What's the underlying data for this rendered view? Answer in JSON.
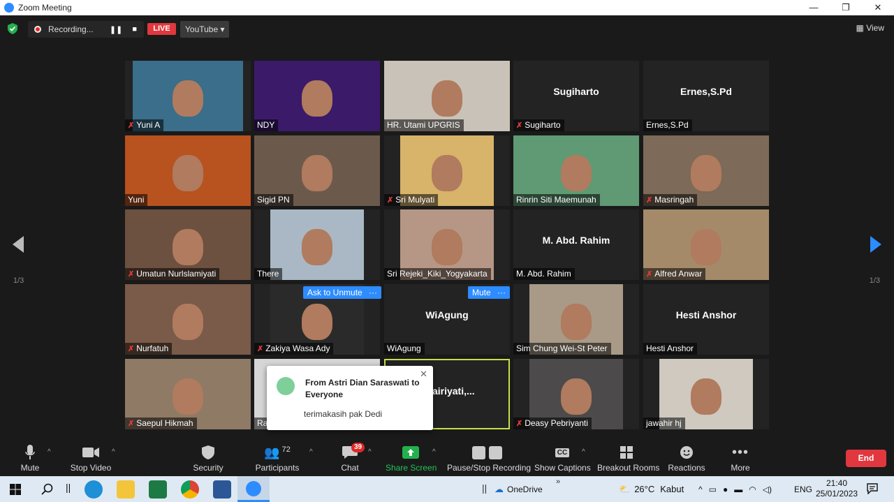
{
  "window": {
    "title": "Zoom Meeting",
    "minimize": "—",
    "restore": "❐",
    "close": "✕"
  },
  "topbar": {
    "recording_label": "Recording...",
    "pause_icon": "❚❚",
    "stop_icon": "■",
    "live_label": "LIVE",
    "stream_target": "YouTube ▾",
    "view_label": "View"
  },
  "pagination": {
    "left": "1/3",
    "right": "1/3"
  },
  "participants": [
    {
      "name": "Yuni A",
      "muted": true,
      "bg": "#3a6e8a"
    },
    {
      "name": "NDY",
      "muted": false,
      "bg": "#3b1a6a"
    },
    {
      "name": "HR. Utami UPGRIS",
      "muted": false,
      "bg": "#c9c2b8"
    },
    {
      "name": "Sugiharto",
      "muted": true,
      "display": "Sugiharto"
    },
    {
      "name": "Ernes,S.Pd",
      "muted": false,
      "display": "Ernes,S.Pd"
    },
    {
      "name": "Yuni",
      "muted": false,
      "bg": "#b8521f"
    },
    {
      "name": "Sigid PN",
      "muted": false,
      "bg": "#6b5a4c"
    },
    {
      "name": "Sri Mulyati",
      "muted": true,
      "bg": "#d8b36a"
    },
    {
      "name": "Rinrin Siti Maemunah",
      "muted": false,
      "bg": "#5f9a74"
    },
    {
      "name": "Masringah",
      "muted": true,
      "bg": "#7d6a58"
    },
    {
      "name": "Umatun Nurlslamiyati",
      "muted": true,
      "bg": "#6c5040"
    },
    {
      "name": "There",
      "muted": false,
      "bg": "#a9b8c4"
    },
    {
      "name": "Sri Rejeki_Kiki_Yogyakarta",
      "muted": false,
      "bg": "#b69785"
    },
    {
      "name": "M. Abd. Rahim",
      "muted": false,
      "display": "M. Abd. Rahim"
    },
    {
      "name": "Alfred Anwar",
      "muted": true,
      "bg": "#a58a6a"
    },
    {
      "name": "Nurfatuh",
      "muted": true,
      "bg": "#7a5a48"
    },
    {
      "name": "Zakiya Wasa Ady",
      "muted": true,
      "bg": "#2a2a2a"
    },
    {
      "name": "WiAgung",
      "muted": false,
      "display": "WiAgung"
    },
    {
      "name": "Sim Chung Wei-St Peter",
      "muted": false,
      "bg": "#a89a86"
    },
    {
      "name": "Hesti Anshor",
      "muted": false,
      "display": "Hesti Anshor"
    },
    {
      "name": "Saepul Hikmah",
      "muted": true,
      "bg": "#8f7a66"
    },
    {
      "name": "Ra",
      "muted": false,
      "bg": "#d6d6d6"
    },
    {
      "name": "ati,MM",
      "muted": false,
      "display": "Chairiyati,..."
    },
    {
      "name": "Deasy Pebriyanti",
      "muted": true,
      "bg": "#4c4a4a"
    },
    {
      "name": "jawahir hj",
      "muted": false,
      "bg": "#cfc9c0"
    }
  ],
  "tile_buttons": {
    "ask_unmute": "Ask to Unmute",
    "mute": "Mute",
    "more": "···"
  },
  "chat_popup": {
    "from": "From Astri Dian Saraswati to Everyone",
    "message": "terimakasih pak Dedi",
    "close": "✕"
  },
  "toolbar": {
    "mute": "Mute",
    "stop_video": "Stop Video",
    "security": "Security",
    "participants": "Participants",
    "participants_count": "72",
    "chat": "Chat",
    "chat_badge": "39",
    "share_screen": "Share Screen",
    "pause_stop_recording": "Pause/Stop Recording",
    "show_captions": "Show Captions",
    "captions_icon": "CC",
    "breakout_rooms": "Breakout Rooms",
    "reactions": "Reactions",
    "more": "More",
    "end": "End"
  },
  "taskbar": {
    "onedrive": "OneDrive",
    "temp": "26°C",
    "weather": "Kabut",
    "lang": "ENG",
    "time": "21:40",
    "date": "25/01/2023",
    "chevron": "»",
    "separator": "||"
  }
}
